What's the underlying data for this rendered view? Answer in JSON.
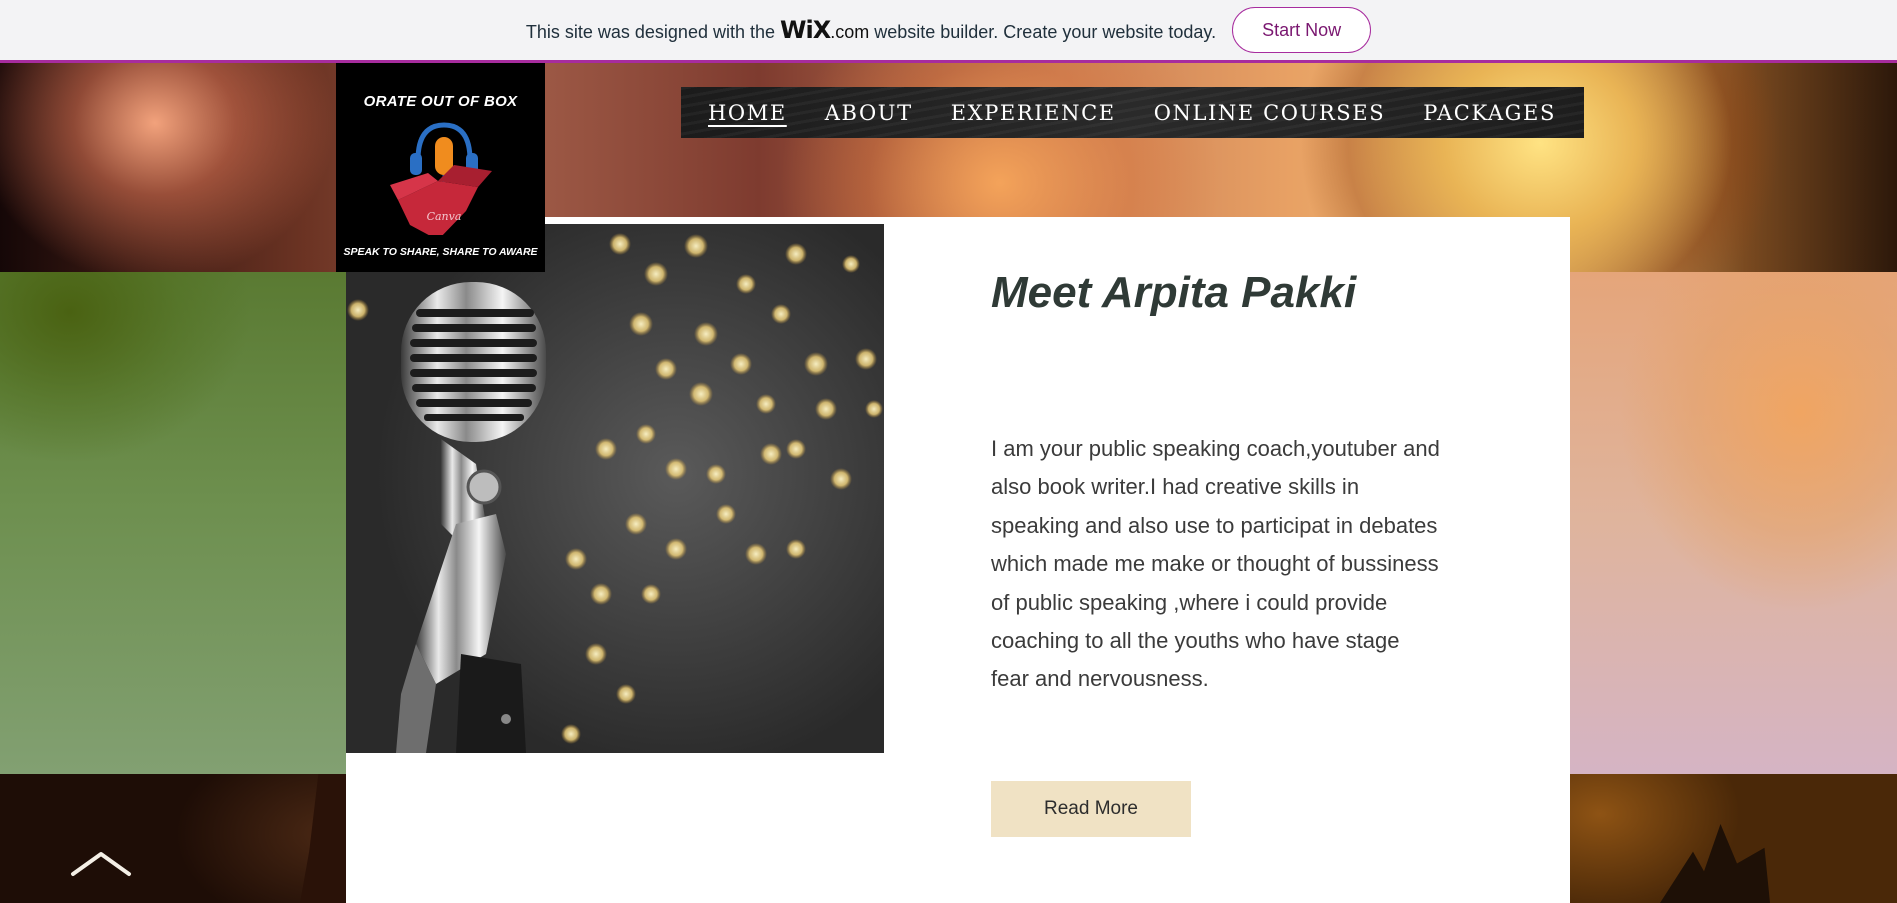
{
  "wix_banner": {
    "text_before": "This site was designed with the",
    "wix_logo": "WiX",
    "wix_dotcom": ".com",
    "text_after": "website builder. Create your website today.",
    "cta_label": "Start Now",
    "accent_color": "#a72c9e"
  },
  "logo": {
    "title": "ORATE OUT OF BOX",
    "tagline": "SPEAK TO SHARE, SHARE TO AWARE",
    "canva_mark": "Canva",
    "icon": "microphone-headphones-box-icon"
  },
  "nav": {
    "items": [
      {
        "label": "HOME",
        "active": true
      },
      {
        "label": "ABOUT",
        "active": false
      },
      {
        "label": "EXPERIENCE",
        "active": false
      },
      {
        "label": "ONLINE COURSES",
        "active": false
      },
      {
        "label": "PACKAGES",
        "active": false
      }
    ]
  },
  "about": {
    "title": "Meet Arpita Pakki",
    "body": "I am your public speaking coach,youtuber and also book writer.I had creative skills in speaking and also use to participat in debates which made me make or thought of bussiness of public speaking ,where i could provide coaching to all the youths who have stage fear and nervousness.",
    "button_label": "Read More",
    "button_color": "#f0e2c4"
  },
  "hero_image": {
    "icon": "vintage-microphone-bokeh-image"
  },
  "back_to_top": {
    "icon": "chevron-up-icon"
  }
}
